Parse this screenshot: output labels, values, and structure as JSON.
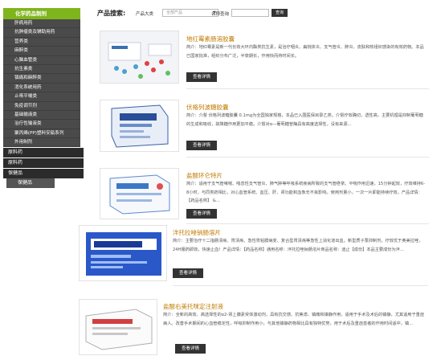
{
  "sidebar": {
    "head": "化学药品制剂",
    "items": [
      "肝病用药",
      "抗肿瘤类及辅助用药",
      "营养类",
      "麻醉类",
      "心脑血管类",
      "抗生素类",
      "镇痛和麻醉类",
      "消化系统用药",
      "止咳平喘类",
      "免疫调节剂",
      "基础输液类",
      "治疗性输液类",
      "聚丙烯(PP)塑料安瓿系列",
      "外用制剂"
    ],
    "cats": [
      "原料药",
      "原料药",
      "保健品"
    ],
    "cat_sub": "保健品"
  },
  "search": {
    "title": "产品搜索:",
    "label_category": "产品大类",
    "select_value": "全部产品",
    "label_name": "名称查询",
    "button": "查询"
  },
  "products": [
    {
      "title": "地红霉素肠溶胶囊",
      "desc": "简介：地红霉素是新一代长效大环内酯类抗生素，是治疗咽炎、扁桃体炎、支气管炎、肺炎、皮肤和软组织感染的有效药物。本品已国家批准，组织分布广泛，半衰期长，作用快而持时间长。",
      "button": "查看详情"
    },
    {
      "title": "伏格列波糖胶囊",
      "desc": "简介：介督 伏格列波糖胶囊 0.1mg为全国独家规格，本品已入围医保目录乙类。介督疗效确切，透性高，主要机理是抑制葡萄糖的生成和吸收，故降糖作用更加平稳。介督对α—葡萄糖苷酶具有高度选择性，没有来源…",
      "button": "查看详情"
    },
    {
      "title": "盐酸环仑特片",
      "desc": "简介：适用于支气管哮喘、喘息性支气管炎、肺气肿等呼吸系统疾病所致的支气管痉挛。平喘作用迅速，15分钟起效，疗效维持6-8小时，与同类药相比，对心血管系统、血压、肝、肾功能和血象无不良影响。使用剂量小，一次一片即能持续疗效，产品详情：【药品名称】 &...",
      "button": "查看详情"
    },
    {
      "title": "泮托拉唑钠肠溶片",
      "desc": "简介：主要治疗十二指肠溃疡、胃溃疡、急性胃粘膜病变、复合型胃溃疡等急性上消化道出血。新型质子泵抑制剂，疗效优于奥美拉唑，24H服药即效，快速止血！产品详情：【药品名称】通用名称：泮托拉唑钠肠溶片商品名称：迪止【成份】本品主要成份为泮...",
      "button": "查看详情"
    },
    {
      "title": "盐酸右美托咪定注射液",
      "desc": "简介：全新的高效、高选择性的α2-肾上腺素受体激动剂，具有抗交感、抗焦虑、镇痛和镇静作用，适用于手术及术后的镇静，尤其适用于重症病人。改善手术期间的心血管稳定性，呼吸抑制作用小，与其他镇静药物相比具有独特优势，用于术后及重症患者的作用时间适中，镇...",
      "button": "查看详情"
    }
  ],
  "colors": {
    "accent": "#7fb51c",
    "title": "#c07a00",
    "dark": "#333333"
  }
}
